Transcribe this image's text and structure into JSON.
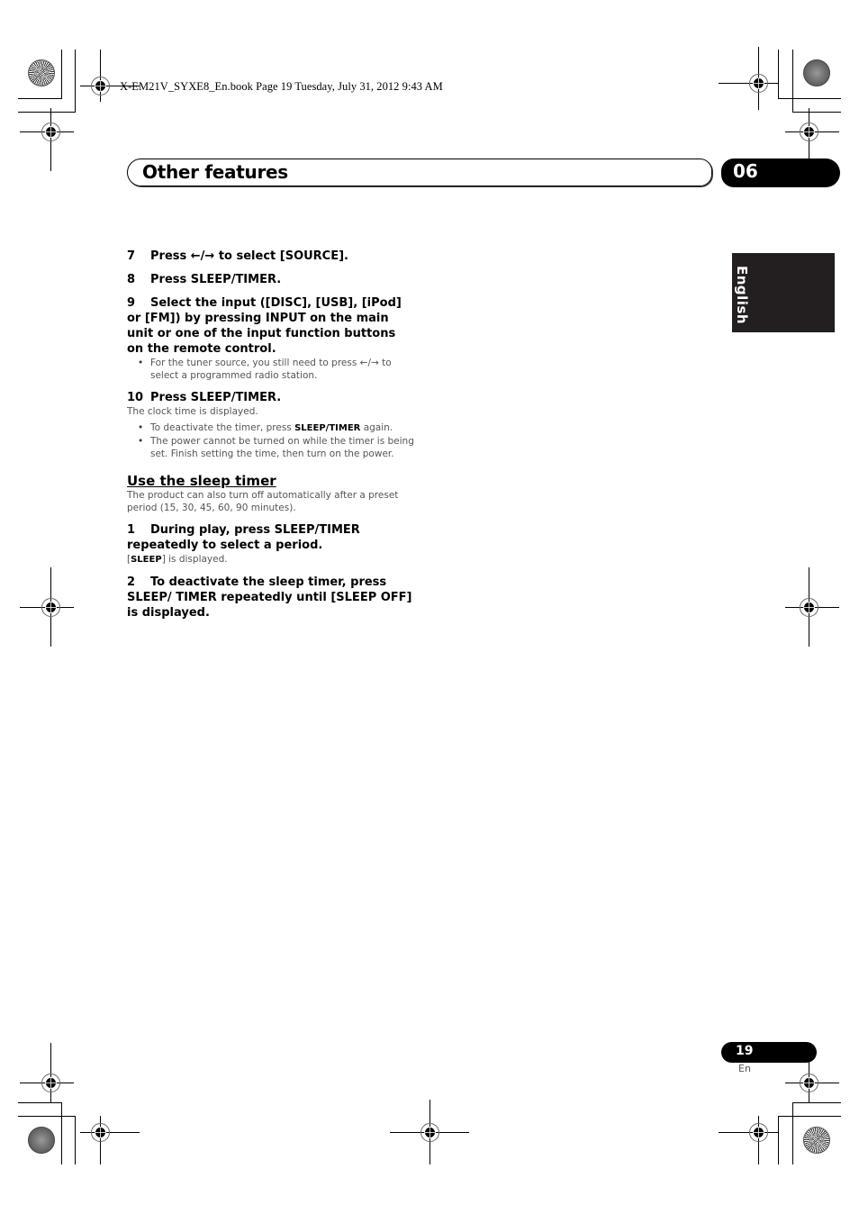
{
  "print_header": "X-EM21V_SYXE8_En.book  Page 19  Tuesday, July 31, 2012  9:43 AM",
  "chapter": {
    "title": "Other features",
    "number": "06"
  },
  "language_tab": "English",
  "steps_top": [
    {
      "num": "7",
      "text": "Press ←/→ to select [SOURCE]."
    },
    {
      "num": "8",
      "text": "Press SLEEP/TIMER."
    },
    {
      "num": "9",
      "text": "Select the input ([DISC], [USB], [iPod] or [FM]) by pressing INPUT on the main unit or one of the input function buttons on the remote control."
    }
  ],
  "step9_bullets": [
    "For the tuner source, you still need to press ←/→ to select a programmed radio station."
  ],
  "step10": {
    "num": "10",
    "text": "Press SLEEP/TIMER.",
    "note": "The clock time is displayed.",
    "bullets": [
      {
        "pre": "To deactivate the timer, press ",
        "bold": "SLEEP/TIMER",
        "post": " again."
      },
      {
        "pre": "The power cannot be turned on while the timer is being set. Finish setting the time, then turn on the power.",
        "bold": "",
        "post": ""
      }
    ]
  },
  "sleep_section": {
    "heading": "Use the sleep timer",
    "intro": "The product can also turn off automatically after a preset period (15, 30, 45, 60, 90 minutes).",
    "step1": {
      "num": "1",
      "text": "During play, press SLEEP/TIMER repeatedly to select a period."
    },
    "step1_note": {
      "pre": "[",
      "bold": "SLEEP",
      "post": "] is displayed."
    },
    "step2": {
      "num": "2",
      "text": "To deactivate the sleep timer, press SLEEP/ TIMER repeatedly until [SLEEP OFF] is displayed."
    }
  },
  "footer": {
    "page_number": "19",
    "language_code": "En"
  }
}
